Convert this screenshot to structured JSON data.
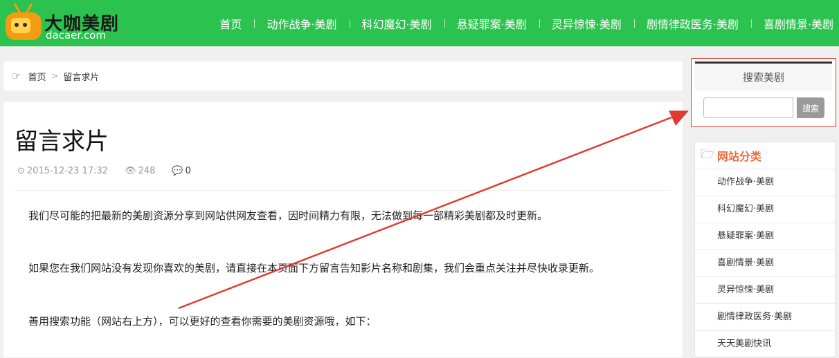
{
  "logo": {
    "title": "大咖美剧",
    "subtitle": "dacaer.com"
  },
  "nav": {
    "items": [
      "首页",
      "动作战争·美剧",
      "科幻魔幻·美剧",
      "悬疑罪案·美剧",
      "灵异惊悚·美剧",
      "剧情律政医务·美剧",
      "喜剧情景·美剧"
    ]
  },
  "breadcrumb": {
    "home": "首页",
    "separator": ">",
    "current": "留言求片"
  },
  "article": {
    "title": "留言求片",
    "date": "2015-12-23 17:32",
    "views": "248",
    "comments": "0",
    "paragraphs": [
      "我们尽可能的把最新的美剧资源分享到网站供网友查看，因时间精力有限，无法做到每一部精彩美剧都及时更新。",
      "如果您在我们网站没有发现你喜欢的美剧，请直接在本页面下方留言告知影片名称和剧集，我们会重点关注并尽快收录更新。",
      "善用搜索功能（网站右上方），可以更好的查看你需要的美剧资源哦，如下："
    ]
  },
  "search": {
    "title": "搜索美剧",
    "input_value": "",
    "button_label": "搜索"
  },
  "categories": {
    "title": "网站分类",
    "items": [
      "动作战争·美剧",
      "科幻魔幻·美剧",
      "悬疑罪案·美剧",
      "喜剧情景·美剧",
      "灵异惊悚·美剧",
      "剧情律政医务·美剧",
      "天天美剧快讯"
    ]
  },
  "colors": {
    "header_green": "#2cc24f",
    "annotation_red": "#e23a2e",
    "category_orange": "#ef6a3a"
  }
}
